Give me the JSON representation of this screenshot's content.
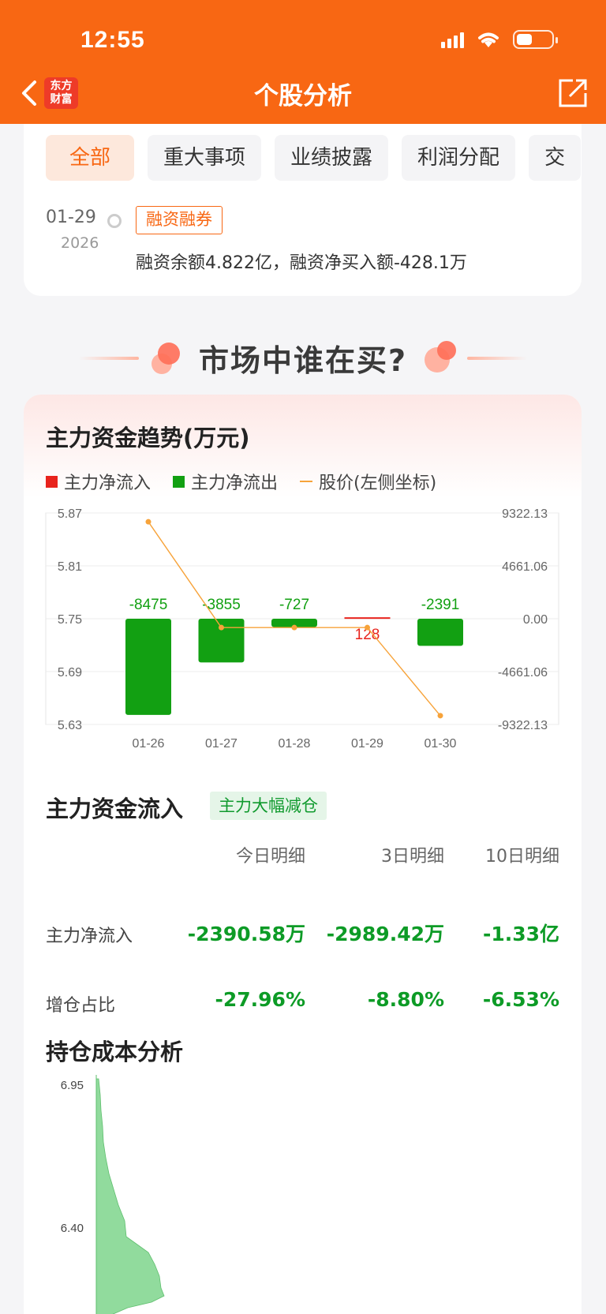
{
  "status_bar": {
    "time": "12:55"
  },
  "nav": {
    "title": "个股分析",
    "logo_line1": "东方",
    "logo_line2": "财富"
  },
  "tabs": [
    "全部",
    "重大事项",
    "业绩披露",
    "利润分配",
    "交"
  ],
  "event": {
    "date": "01-29",
    "year": "2026",
    "tag": "融资融券",
    "text": "融资余额4.822亿，融资净买入额-428.1万"
  },
  "section_heading": "市场中谁在买?",
  "trend": {
    "title": "主力资金趋势(万元)",
    "legend": [
      "主力净流入",
      "主力净流出",
      "股价(左侧坐标)"
    ]
  },
  "colors": {
    "accent": "#f86713",
    "inflow": "#e8231c",
    "outflow": "#12a012",
    "price": "#f7a33a"
  },
  "chart_data": {
    "type": "bar",
    "categories": [
      "01-26",
      "01-27",
      "01-28",
      "01-29",
      "01-30"
    ],
    "series": [
      {
        "name": "主力净流入/流出",
        "values": [
          -8475,
          -3855,
          -727,
          128,
          -2391
        ]
      },
      {
        "name": "股价(左侧坐标)",
        "values": [
          5.86,
          5.74,
          5.74,
          5.74,
          5.64
        ]
      }
    ],
    "left_ticks": [
      "5.87",
      "5.81",
      "5.75",
      "5.69",
      "5.63"
    ],
    "right_ticks": [
      "9322.13",
      "4661.06",
      "0.00",
      "-4661.06",
      "-9322.13"
    ],
    "bar_labels": [
      "-8475",
      "-3855",
      "-727",
      "128",
      "-2391"
    ],
    "ylim_left": [
      5.63,
      5.87
    ],
    "ylim_right": [
      -9322.13,
      9322.13
    ]
  },
  "flow": {
    "title": "主力资金流入",
    "badge": "主力大幅减仓",
    "headers": [
      "今日明细",
      "3日明细",
      "10日明细"
    ],
    "rows": [
      {
        "label": "主力净流入",
        "values": [
          "-2390.58万",
          "-2989.42万",
          "-1.33亿"
        ]
      },
      {
        "label": "增仓占比",
        "values": [
          "-27.96%",
          "-8.80%",
          "-6.53%"
        ]
      }
    ]
  },
  "cost": {
    "title": "持仓成本分析",
    "tick_labels": [
      "6.95",
      "6.40"
    ]
  }
}
